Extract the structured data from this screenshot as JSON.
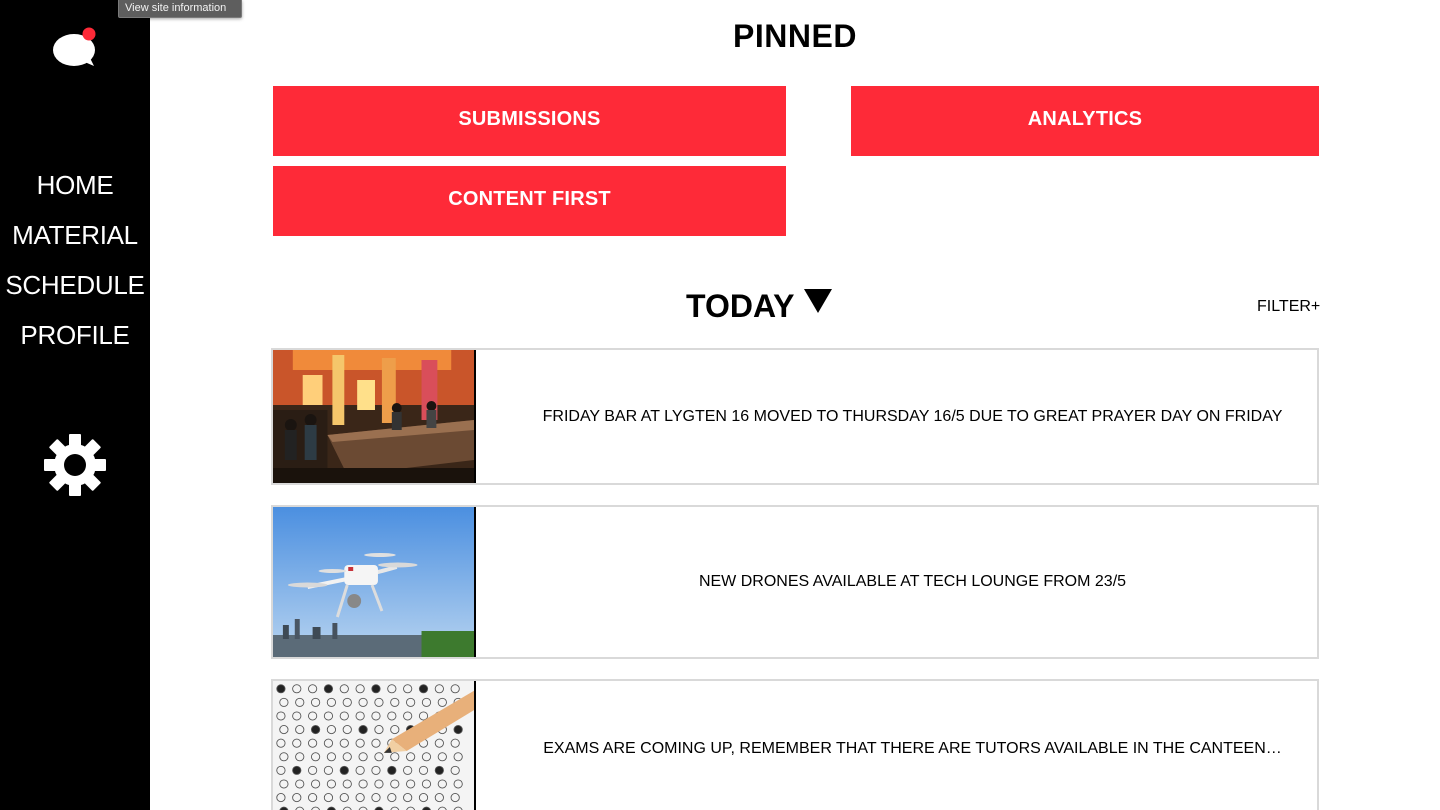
{
  "tooltip": "View site information",
  "sidebar": {
    "logo": "chat-bubble-notification-icon",
    "items": [
      {
        "label": "HOME"
      },
      {
        "label": "MATERIAL"
      },
      {
        "label": "SCHEDULE"
      },
      {
        "label": "PROFILE"
      }
    ],
    "settings_icon": "gear-icon"
  },
  "pinned": {
    "title": "PINNED",
    "buttons": [
      {
        "label": "SUBMISSIONS"
      },
      {
        "label": "ANALYTICS"
      },
      {
        "label": "CONTENT FIRST"
      }
    ]
  },
  "feed": {
    "heading": "TODAY",
    "heading_icon": "triangle-down-icon",
    "filter_label": "FILTER+",
    "items": [
      {
        "image": "bar-interior-photo",
        "text": "FRIDAY BAR AT LYGTEN 16 MOVED TO THURSDAY 16/5 DUE TO GREAT PRAYER DAY ON FRIDAY"
      },
      {
        "image": "drone-photo",
        "text": "NEW DRONES AVAILABLE AT TECH LOUNGE FROM 23/5"
      },
      {
        "image": "exam-sheet-photo",
        "text": "EXAMS ARE COMING UP, REMEMBER THAT THERE ARE TUTORS AVAILABLE IN THE CANTEEN…"
      }
    ]
  },
  "colors": {
    "accent": "#fe2a38",
    "sidebar_bg": "#000000",
    "card_border": "#d9d9d9"
  }
}
